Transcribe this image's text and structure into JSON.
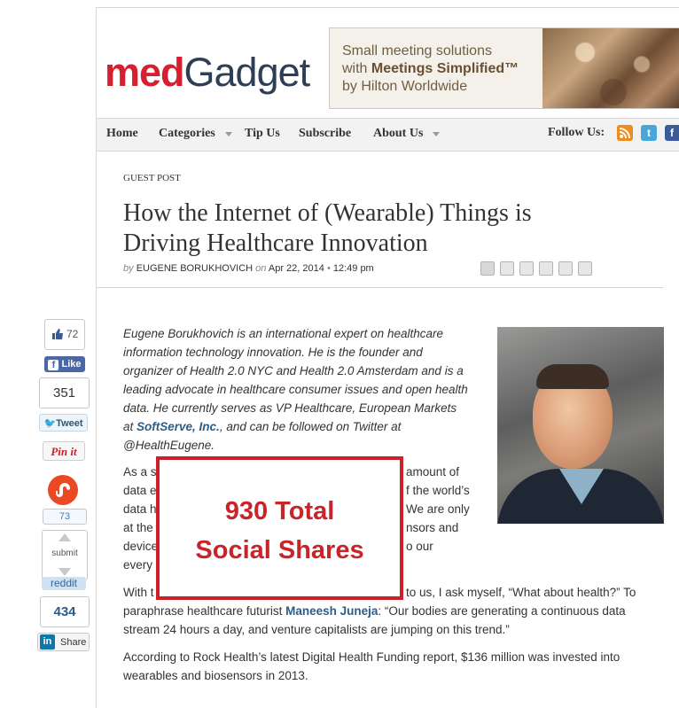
{
  "site": {
    "logo_primary": "med",
    "logo_secondary": "Gadget"
  },
  "ad": {
    "line1": "Small meeting solutions",
    "line2_prefix": "with ",
    "line2_bold": "Meetings Simplified™",
    "line3": "by Hilton Worldwide"
  },
  "nav": {
    "items": [
      "Home",
      "Categories",
      "Tip Us",
      "Subscribe",
      "About Us"
    ],
    "follow_label": "Follow Us:"
  },
  "social_icons": [
    "rss-icon",
    "twitter-icon",
    "facebook-icon"
  ],
  "article": {
    "kicker": "GUEST POST",
    "title_line1": "How the Internet of (Wearable) Things is",
    "title_line2": "Driving Healthcare Innovation",
    "byline_prefix": "by",
    "author": "EUGENE BORUKHOVICH",
    "date_prefix": "on",
    "date": "Apr 22, 2014",
    "time_sep": "•",
    "time": "12:49 pm",
    "intro": {
      "l1": "Eugene Borukhovich is an international expert on healthcare",
      "l2": "information technology innovation. He is the founder and",
      "l3": "organizer of Health 2.0 NYC and Health 2.0 Amsterdam and is a",
      "l4": "leading advocate in healthcare consumer issues and open health",
      "l5": "data. He currently serves as VP Healthcare, European Markets",
      "l6_prefix": "at ",
      "l6_link": "SoftServe, Inc.",
      "l6_suffix": ", and can be followed on Twitter at",
      "l7": "@HealthEugene."
    },
    "para2": {
      "l1a": "As a s",
      "l1b": "amount of",
      "l2a": "data e",
      "l2b": "f the world’s",
      "l3a": "data h",
      "l3b": "We are only",
      "l4a": "at the",
      "l4b": "nsors and",
      "l5a": "device",
      "l5b": "o our",
      "l6a": "every"
    },
    "para3": {
      "l1a": "With t",
      "l1b": "to us, I ask myself, “What about health?” To",
      "l2_prefix": "paraphrase healthcare futurist ",
      "l2_link": "Maneesh Juneja",
      "l2_suffix": ": “Our bodies are generating a continuous data",
      "l3": "stream 24 hours a day, and venture capitalists are jumping on this trend.”"
    },
    "para4": {
      "l1": "According to Rock Health’s latest Digital Health Funding report, $136 million was invested into",
      "l2": "wearables and biosensors in 2013."
    }
  },
  "overlay": {
    "line1": "930 Total",
    "line2": "Social Shares"
  },
  "share": {
    "like_count": "72",
    "like_label": "Like",
    "tweet_count": "351",
    "tweet_label": "Tweet",
    "pin_label": "Pin it",
    "stumble_count": "73",
    "reddit_submit": "submit",
    "reddit_label": "reddit",
    "linkedin_count": "434",
    "linkedin_label": "Share"
  },
  "colors": {
    "brand_red": "#d62030",
    "brand_navy": "#2e3e55",
    "overlay_red": "#cc1f28",
    "link_blue": "#2a5d8a"
  }
}
